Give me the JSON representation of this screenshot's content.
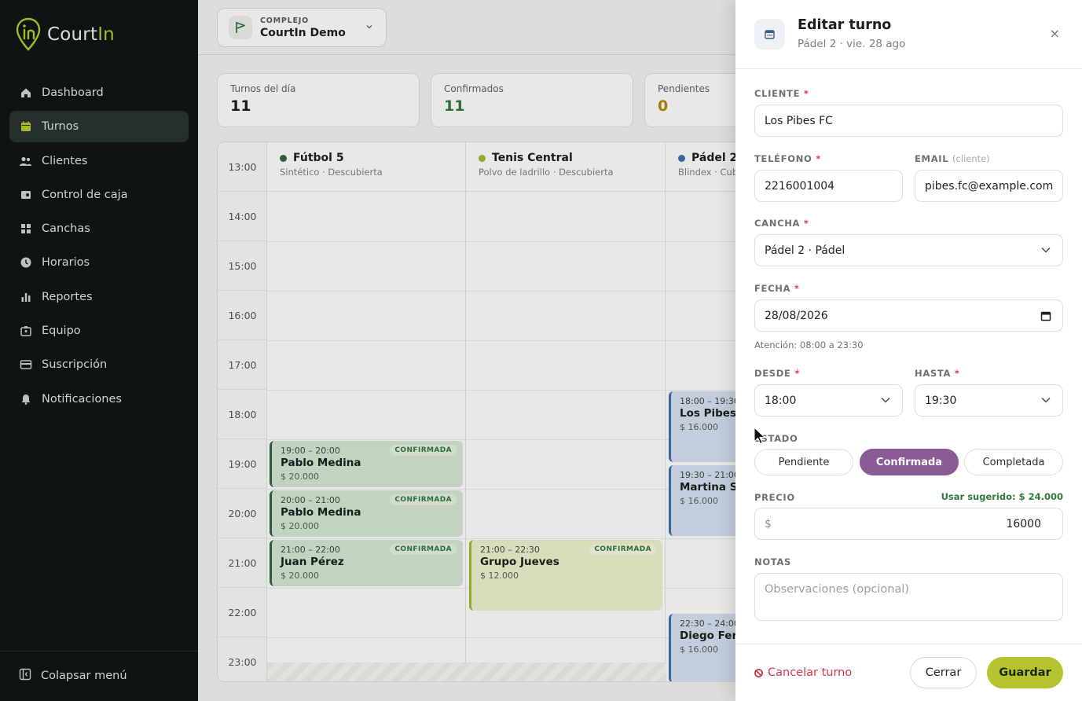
{
  "brand": {
    "name_main": "Court",
    "name_accent": "In"
  },
  "sidebar": {
    "items": [
      {
        "label": "Dashboard",
        "icon": "home-icon"
      },
      {
        "label": "Turnos",
        "icon": "calendar-icon",
        "active": true
      },
      {
        "label": "Clientes",
        "icon": "users-icon"
      },
      {
        "label": "Control de caja",
        "icon": "cashbox-icon"
      },
      {
        "label": "Canchas",
        "icon": "grid-icon"
      },
      {
        "label": "Horarios",
        "icon": "clock-icon"
      },
      {
        "label": "Reportes",
        "icon": "bar-chart-icon"
      },
      {
        "label": "Equipo",
        "icon": "badge-icon"
      },
      {
        "label": "Suscripción",
        "icon": "credit-card-icon"
      },
      {
        "label": "Notificaciones",
        "icon": "bell-icon"
      }
    ],
    "collapse_label": "Colapsar menú"
  },
  "topbar": {
    "complex_label": "COMPLEJO",
    "complex_value": "CourtIn Demo"
  },
  "stats": [
    {
      "label": "Turnos del día",
      "value": "11",
      "color": "#1c1f1c"
    },
    {
      "label": "Confirmados",
      "value": "11",
      "color": "#2f7a3c"
    },
    {
      "label": "Pendientes",
      "value": "0",
      "color": "#b8860b"
    }
  ],
  "schedule": {
    "hours": [
      "13:00",
      "14:00",
      "15:00",
      "16:00",
      "17:00",
      "18:00",
      "19:00",
      "20:00",
      "21:00",
      "22:00",
      "23:00"
    ],
    "courts": [
      {
        "name": "Fútbol 5",
        "sub": "Sintético · Descubierta",
        "color": "#2d6a3f"
      },
      {
        "name": "Tenis Central",
        "sub": "Polvo de ladrillo · Descubierta",
        "color": "#a8b82a"
      },
      {
        "name": "Pádel 2",
        "sub": "Blindex · Cub",
        "color": "#3f6fb3"
      }
    ],
    "bookings": [
      {
        "time": "19:00 – 20:00",
        "name": "Pablo Medina",
        "price": "$ 20.000",
        "badge": "CONFIRMADA"
      },
      {
        "time": "20:00 – 21:00",
        "name": "Pablo Medina",
        "price": "$ 20.000",
        "badge": "CONFIRMADA"
      },
      {
        "time": "21:00 – 22:00",
        "name": "Juan Pérez",
        "price": "$ 20.000",
        "badge": "CONFIRMADA"
      },
      {
        "time": "21:00 – 22:30",
        "name": "Grupo Jueves",
        "price": "$ 12.000",
        "badge": "CONFIRMADA"
      },
      {
        "time": "18:00 – 19:30",
        "name": "Los Pibes FC",
        "price": "$ 16.000"
      },
      {
        "time": "19:30 – 21:00",
        "name": "Martina Sos",
        "price": "$ 16.000"
      },
      {
        "time": "22:30 – 24:00",
        "name": "Diego Ferná",
        "price": "$ 16.000"
      }
    ]
  },
  "drawer": {
    "title": "Editar turno",
    "subtitle": "Pádel 2 · vie. 28 ago",
    "close_glyph": "×",
    "client_label": "CLIENTE",
    "client_value": "Los Pibes FC",
    "phone_label": "TELÉFONO",
    "phone_value": "2216001004",
    "email_label": "EMAIL",
    "email_hint": "(cliente)",
    "email_value": "pibes.fc@example.com",
    "court_label": "CANCHA",
    "court_value": "Pádel 2 · Pádel",
    "date_label": "FECHA",
    "date_value": "28/08/2026",
    "attention": "Atención: 08:00 a 23:30",
    "from_label": "DESDE",
    "from_value": "18:00",
    "to_label": "HASTA",
    "to_value": "19:30",
    "state_label": "ESTADO",
    "states": [
      "Pendiente",
      "Confirmada",
      "Completada"
    ],
    "selected_state": "Confirmada",
    "price_label": "PRECIO",
    "suggest": "Usar sugerido: $ 24.000",
    "currency": "$",
    "price_value": "16000",
    "notes_label": "NOTAS",
    "notes_placeholder": "Observaciones (opcional)",
    "cancel_label": "Cancelar turno",
    "close_label": "Cerrar",
    "save_label": "Guardar",
    "required_mark": "*"
  },
  "colors": {
    "accent": "#b4c52f",
    "sidebar_bg": "#0f1714",
    "selected_state": "#8c5b97",
    "danger": "#d2374a"
  }
}
